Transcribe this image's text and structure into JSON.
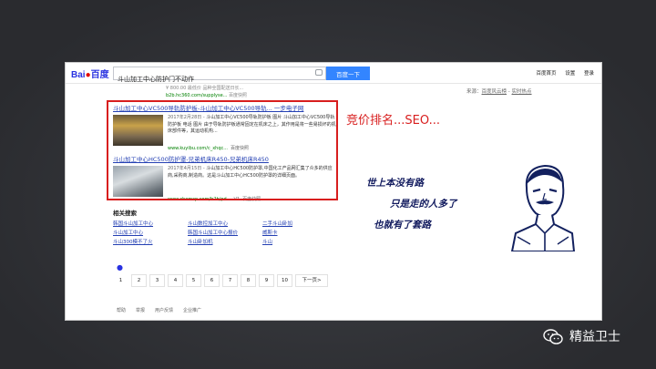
{
  "search": {
    "logo_text": "Bai",
    "logo_text2": "百度",
    "query": "斗山加工中心防护门不动作",
    "button_label": "百度一下"
  },
  "top_nav": [
    "百度首页",
    "设置",
    "登录"
  ],
  "prev_result": {
    "line1": "¥ 800.00 最低价 品种全国配送日长...",
    "url": "b2b.hc360.com/supplyse...",
    "snapshot": "百度快照"
  },
  "right_links": {
    "source": "来源：",
    "link1": "百度风云榜",
    "sep": " - ",
    "link2": "实时热点"
  },
  "results": [
    {
      "title": "斗山加工中心VC500导轨防护板-斗山加工中心VC500导轨... 一步电子网",
      "date": "2017年2月28日 -",
      "abstract": "斗山加工中心VC500导轨防护板 图片 斗山加工中心VC500导轨防护板 电话 图片 由于导轨防护板通常固定在机床之上，其作用是将一些易损坏的机床部件等，其运动机构...",
      "url": "www.kuyibu.com/c_xhqc...",
      "snapshot": "百度快照"
    },
    {
      "title": "斗山加工中心HC500防护罩-兄弟机床R450-兄弟机床R450",
      "date": "2017年4月15日 -",
      "abstract": "斗山加工中心HC500防护罩,中国化工产品网汇集了众多的供应商,采购商,制造商。这是斗山加工中心HC500防护罩的详细页面。",
      "url": "www.chemcp.com/b2b/pd...",
      "v": "V1",
      "snapshot": "百度快照"
    }
  ],
  "related": {
    "heading": "相关搜索",
    "items": [
      "韩国斗山加工中心",
      "斗山数控加工中心",
      "二手斗山卧加",
      "斗山加工中心",
      "韩国斗山加工中心报价",
      "威斯卡",
      "斗山300模不了火",
      "斗山卧加机",
      "斗山"
    ]
  },
  "pagination": {
    "pages": [
      "1",
      "2",
      "3",
      "4",
      "5",
      "6",
      "7",
      "8",
      "9",
      "10"
    ],
    "current": "1",
    "next": "下一页>"
  },
  "footer": [
    "帮助",
    "举报",
    "用户反馈",
    "企业推广"
  ],
  "annotation": "竞价排名...SEO...",
  "quote": {
    "line1": "世上本没有路",
    "line2": "只是走的人多了",
    "line3": "也就有了套路"
  },
  "brand": {
    "name": "精益卫士"
  },
  "colors": {
    "baidu_blue": "#3385ff",
    "link": "#2440b3",
    "url_green": "#008000",
    "highlight_red": "#d81e1e",
    "quote_ink": "#111a5e"
  },
  "icons": [
    "baidu-paw-icon",
    "camera-icon",
    "wechat-icon",
    "lu-xun-portrait"
  ]
}
